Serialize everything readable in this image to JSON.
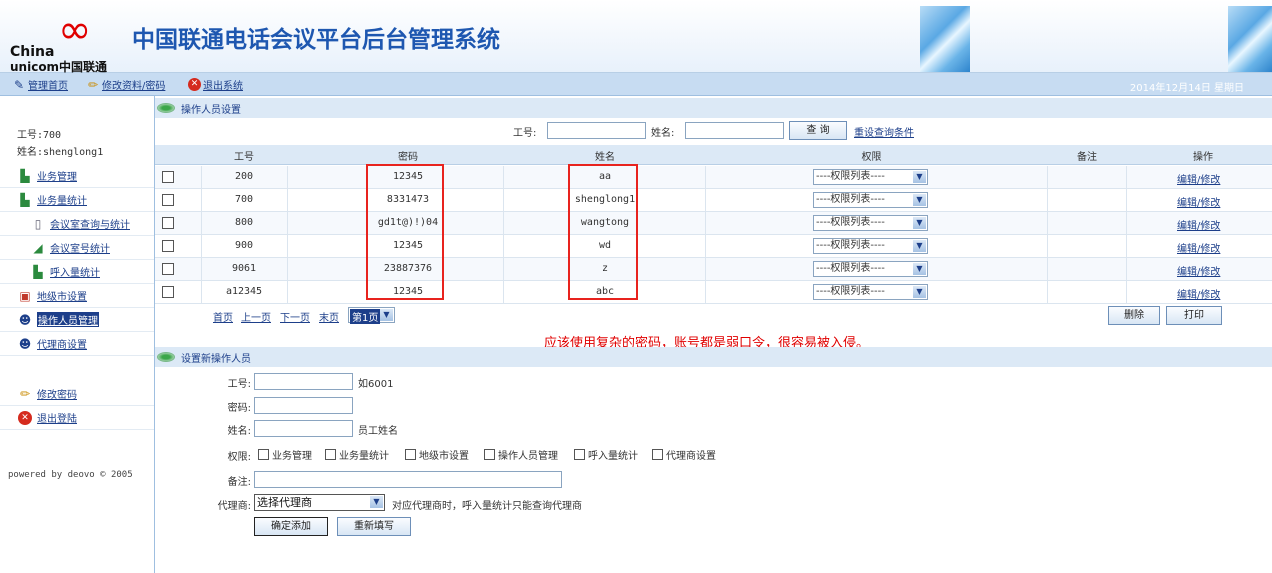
{
  "header": {
    "logo_china": "China",
    "logo_unicom": "unicom中国联通",
    "title": "中国联通电话会议平台后台管理系统"
  },
  "toolbar": {
    "home": "管理首页",
    "edit_profile": "修改资料/密码",
    "logout": "退出系统",
    "date": "2014年12月14日 星期日"
  },
  "sidebar": {
    "emp_id": "工号:700",
    "name": "姓名:shenglong1",
    "items": [
      {
        "label": "业务管理",
        "icon": "chart-icon"
      },
      {
        "label": "业务量统计",
        "icon": "chart-icon"
      },
      {
        "label": "会议室查询与统计",
        "icon": "document-icon"
      },
      {
        "label": "会议室号统计",
        "icon": "graph-icon"
      },
      {
        "label": "呼入量统计",
        "icon": "chart-icon"
      },
      {
        "label": "地级市设置",
        "icon": "map-icon"
      },
      {
        "label": "操作人员管理",
        "icon": "users-icon"
      },
      {
        "label": "代理商设置",
        "icon": "users-icon"
      },
      {
        "label": "修改密码",
        "icon": "pencil-icon"
      },
      {
        "label": "退出登陆",
        "icon": "close-icon"
      }
    ],
    "powered": "powered by deovo © 2005"
  },
  "section1": {
    "title": "操作人员设置",
    "search": {
      "emp_label": "工号:",
      "name_label": "姓名:",
      "query_button": "查 询",
      "reset_link": "重设查询条件"
    },
    "columns": [
      "工号",
      "密码",
      "姓名",
      "权限",
      "备注",
      "操作"
    ],
    "rows": [
      {
        "emp_id": "200",
        "password": "12345",
        "name": "aa",
        "permission": "----权限列表----",
        "note": "",
        "action": "编辑/修改"
      },
      {
        "emp_id": "700",
        "password": "8331473",
        "name": "shenglong1",
        "permission": "----权限列表----",
        "note": "",
        "action": "编辑/修改"
      },
      {
        "emp_id": "800",
        "password": "gd1t@)!)04",
        "name": "wangtong",
        "permission": "----权限列表----",
        "note": "",
        "action": "编辑/修改"
      },
      {
        "emp_id": "900",
        "password": "12345",
        "name": "wd",
        "permission": "----权限列表----",
        "note": "",
        "action": "编辑/修改"
      },
      {
        "emp_id": "9061",
        "password": "23887376",
        "name": "z",
        "permission": "----权限列表----",
        "note": "",
        "action": "编辑/修改"
      },
      {
        "emp_id": "a12345",
        "password": "12345",
        "name": "abc",
        "permission": "----权限列表----",
        "note": "",
        "action": "编辑/修改"
      }
    ],
    "pager": {
      "first": "首页",
      "prev": "上一页",
      "next": "下一页",
      "last": "末页",
      "current": "第1页",
      "delete_button": "删除",
      "print_button": "打印"
    }
  },
  "annotation": "应该使用复杂的密码，账号都是弱口令，很容易被入侵。",
  "section2": {
    "title": "设置新操作人员",
    "emp_label": "工号:",
    "emp_hint": "如6001",
    "pwd_label": "密码:",
    "name_label": "姓名:",
    "name_hint": "员工姓名",
    "perm_label": "权限:",
    "permissions": [
      "业务管理",
      "业务量统计",
      "地级市设置",
      "操作人员管理",
      "呼入量统计",
      "代理商设置"
    ],
    "note_label": "备注:",
    "agent_label": "代理商:",
    "agent_value": "选择代理商",
    "agent_hint": "对应代理商时，呼入量统计只能查询代理商",
    "submit_button": "确定添加",
    "refill_button": "重新填写"
  }
}
